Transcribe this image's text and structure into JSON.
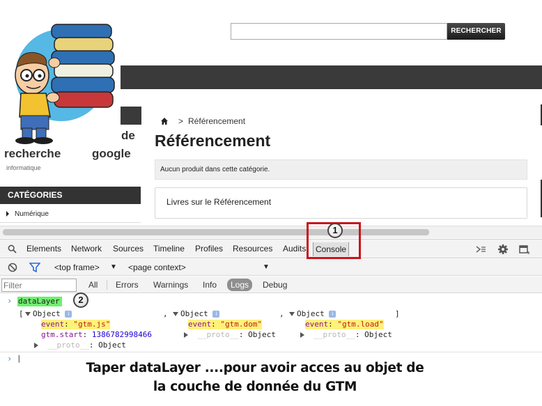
{
  "site": {
    "search_button": "RECHERCHER",
    "title_de": "de",
    "title_recherche": "recherche",
    "title_google": "google",
    "tagline": "informatique",
    "categories_header": "CATÉGORIES",
    "category_item": "Numérique",
    "breadcrumb_sep": ">",
    "breadcrumb_current": "Référencement",
    "page_title": "Référencement",
    "alert_text": "Aucun produit dans cette catégorie.",
    "subcategory": "Livres sur le Référencement"
  },
  "devtools": {
    "tabs": [
      "Elements",
      "Network",
      "Sources",
      "Timeline",
      "Profiles",
      "Resources",
      "Audits",
      "Console"
    ],
    "frame_select": "<top frame>",
    "context_select": "<page context>",
    "filter_placeholder": "Filter",
    "levels": [
      "All",
      "Errors",
      "Warnings",
      "Info",
      "Logs",
      "Debug"
    ],
    "active_level": "Logs"
  },
  "console": {
    "command": "dataLayer",
    "open_bracket": "[",
    "close_bracket": "]",
    "comma": ",",
    "objects": [
      {
        "label": "Object",
        "event_key": "event",
        "event_value": "\"gtm.js\"",
        "extra_key": "gtm.start",
        "extra_value": "1386782998466",
        "proto_key": "__proto__",
        "proto_value": "Object"
      },
      {
        "label": "Object",
        "event_key": "event",
        "event_value": "\"gtm.dom\"",
        "proto_key": "__proto__",
        "proto_value": "Object"
      },
      {
        "label": "Object",
        "event_key": "event",
        "event_value": "\"gtm.load\"",
        "proto_key": "__proto__",
        "proto_value": "Object"
      }
    ],
    "obj_icon": "i"
  },
  "annotations": {
    "marker_1": "1",
    "marker_2": "2",
    "caption_line1": "Taper dataLayer ....pour avoir acces au objet de",
    "caption_line2": "la couche de donnée du GTM"
  },
  "icons": [
    "home-icon",
    "search-icon",
    "settings-gear-icon",
    "dock-icon",
    "clear-console-icon",
    "filter-funnel-icon"
  ],
  "colors": {
    "highlight_command": "#6df06d",
    "highlight_event": "#fff27a",
    "annotation_red": "#c8151b",
    "dark_bar": "#3a3a3a"
  }
}
